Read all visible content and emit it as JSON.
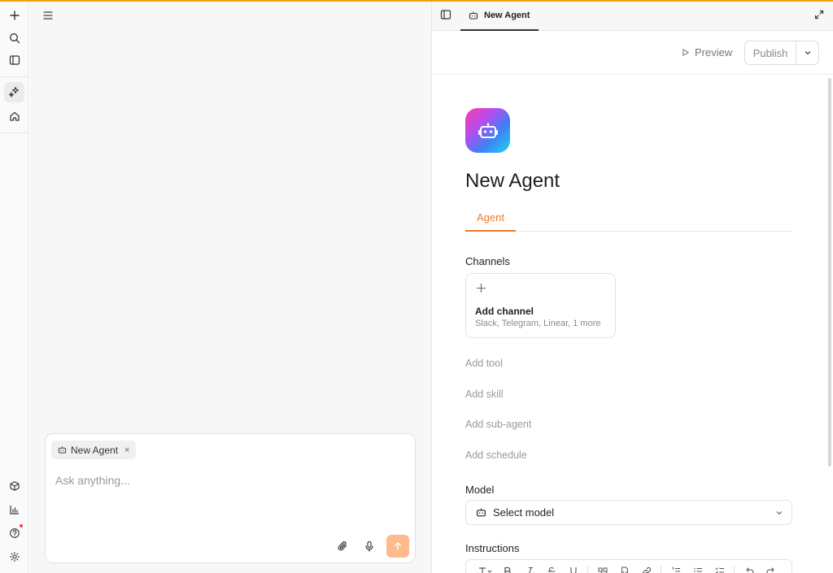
{
  "chat": {
    "chip_label": "New Agent",
    "chip_close": "×",
    "input_placeholder": "Ask anything..."
  },
  "panel": {
    "tab_label": "New Agent",
    "preview_label": "Preview",
    "publish_label": "Publish",
    "agent_name": "New Agent",
    "subtab_label": "Agent",
    "channels_label": "Channels",
    "channel_card": {
      "plus": "+",
      "title": "Add channel",
      "subtitle": "Slack, Telegram, Linear, 1 more"
    },
    "add_links": [
      "Add tool",
      "Add skill",
      "Add sub-agent",
      "Add schedule"
    ],
    "model_label": "Model",
    "model_select": "Select model",
    "instructions_label": "Instructions"
  },
  "colors": {
    "accent": "#ea7a2f",
    "topline": "#f59e0b",
    "send_button": "#fdba8c"
  }
}
